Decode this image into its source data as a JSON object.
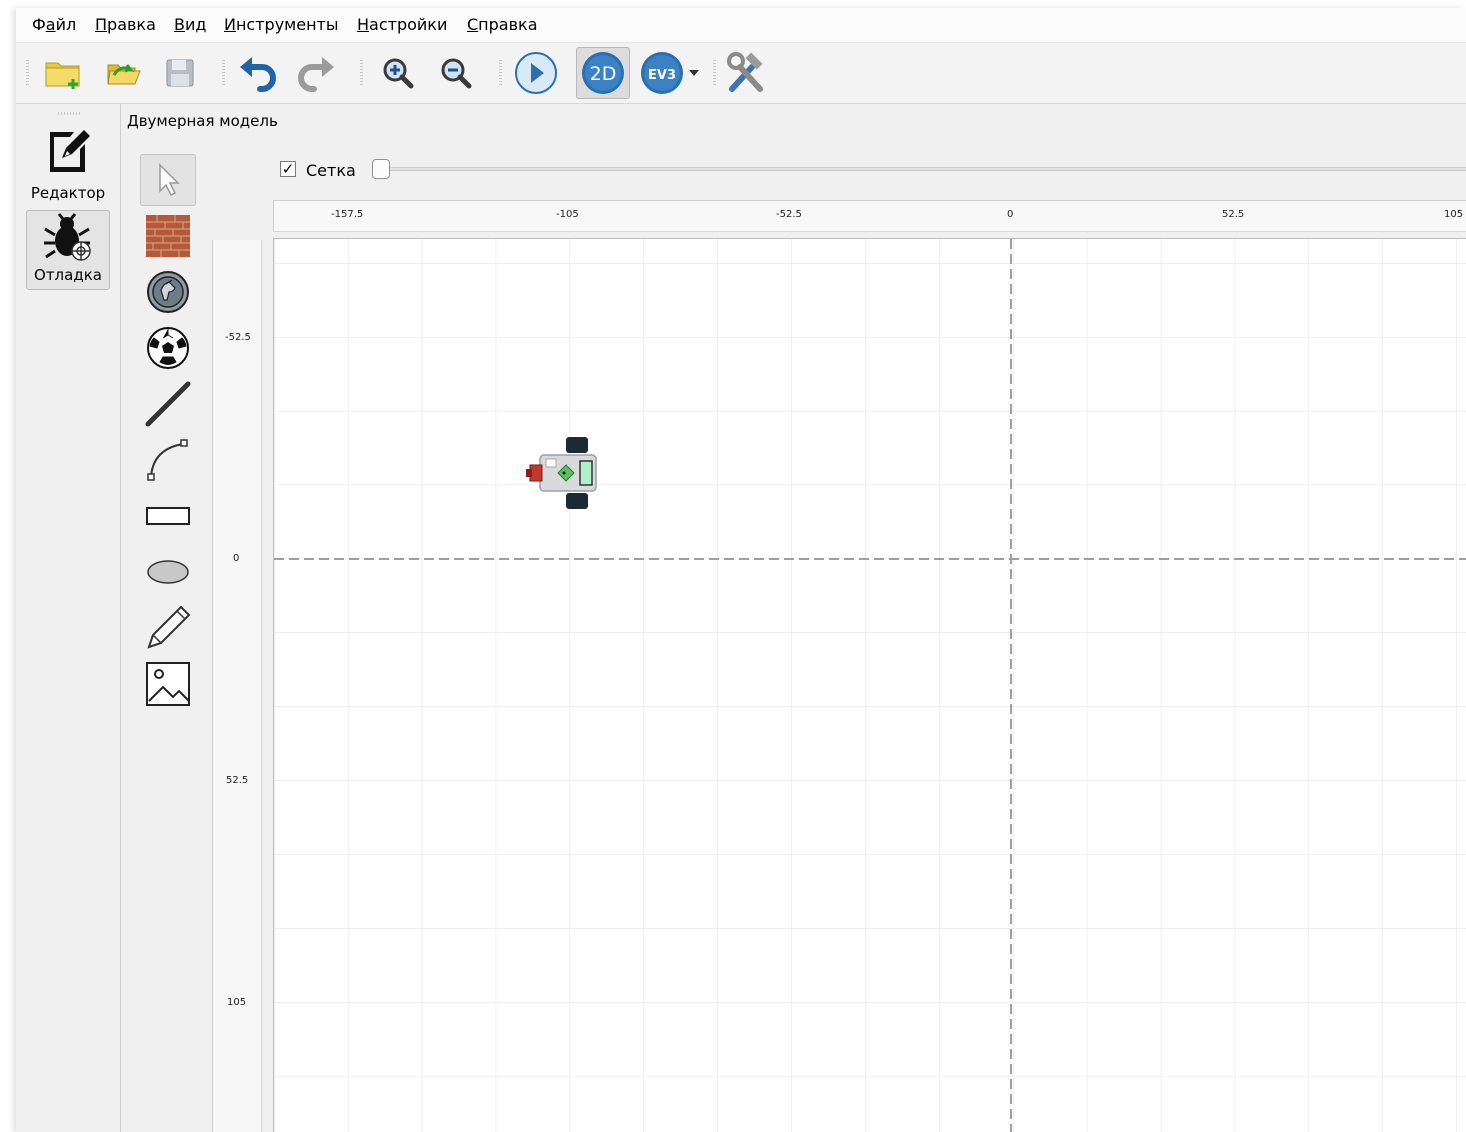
{
  "menu": {
    "items": [
      {
        "pre": "Ф",
        "u": "а",
        "post": "йл"
      },
      {
        "pre": "",
        "u": "П",
        "post": "равка"
      },
      {
        "pre": "",
        "u": "В",
        "post": "ид"
      },
      {
        "pre": "",
        "u": "И",
        "post": "нструменты"
      },
      {
        "pre": "",
        "u": "Н",
        "post": "астройки"
      },
      {
        "pre": "",
        "u": "С",
        "post": "правка"
      }
    ]
  },
  "toolbar": {
    "buttons": [
      "new-project-icon",
      "open-icon",
      "save-icon",
      "undo-icon",
      "redo-icon",
      "zoom-in-icon",
      "zoom-out-icon",
      "run-icon",
      "2d-model-icon",
      "ev3-icon",
      "settings-tools-icon"
    ],
    "twod_label": "2D",
    "ev3_label": "EV3"
  },
  "modes": {
    "editor_label": "Редактор",
    "debug_label": "Отладка",
    "active": "debug"
  },
  "content": {
    "title": "Двумерная модель",
    "grid_label": "Сетка",
    "grid_checked": true,
    "grid_check_mark": "✓",
    "grid_size_fraction": 0.0
  },
  "palette": [
    "pointer-icon",
    "wall-icon",
    "skittle-icon",
    "ball-icon",
    "line-icon",
    "bezier-curve-icon",
    "rectangle-icon",
    "ellipse-icon",
    "pencil-icon",
    "image-icon"
  ],
  "rulers": {
    "x_ticks": [
      "-157.5",
      "-105",
      "-52.5",
      "0",
      "52.5",
      "105"
    ],
    "y_ticks": [
      "-52.5",
      "0",
      "52.5",
      "105"
    ]
  },
  "colors": {
    "accent_blue": "#2a6fb0",
    "grid_line": "#e2e2e2",
    "axis_line": "#9e9e9e"
  }
}
